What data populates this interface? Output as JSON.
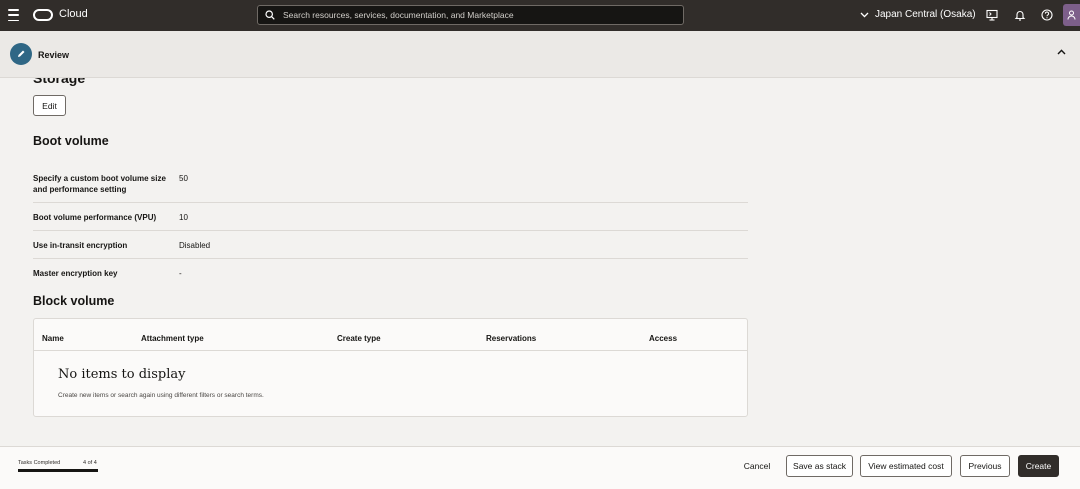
{
  "topbar": {
    "brand": "Cloud",
    "search_placeholder": "Search resources, services, documentation, and Marketplace",
    "region": "Japan Central (Osaka)"
  },
  "review": {
    "label": "Review"
  },
  "storage": {
    "title": "Storage",
    "edit_label": "Edit"
  },
  "boot_volume": {
    "title": "Boot volume",
    "rows": [
      {
        "key": "Specify a custom boot volume size and performance setting",
        "value": "50"
      },
      {
        "key": "Boot volume performance (VPU)",
        "value": "10"
      },
      {
        "key": "Use in-transit encryption",
        "value": "Disabled"
      },
      {
        "key": "Master encryption key",
        "value": "-"
      }
    ]
  },
  "block_volume": {
    "title": "Block volume",
    "columns": [
      "Name",
      "Attachment type",
      "Create type",
      "Reservations",
      "Access"
    ],
    "empty_title": "No items to display",
    "empty_sub": "Create new items or search again using different filters or search terms."
  },
  "footer": {
    "tasks_label": "Tasks Completed",
    "tasks_count": "4 of 4",
    "progress_fraction": 1.0,
    "cancel": "Cancel",
    "save_stack": "Save as stack",
    "estimated_cost": "View estimated cost",
    "previous": "Previous",
    "create": "Create"
  },
  "colors": {
    "topbar": "#312d2a",
    "accent": "#2f6785",
    "primary_button": "#312d2a"
  }
}
